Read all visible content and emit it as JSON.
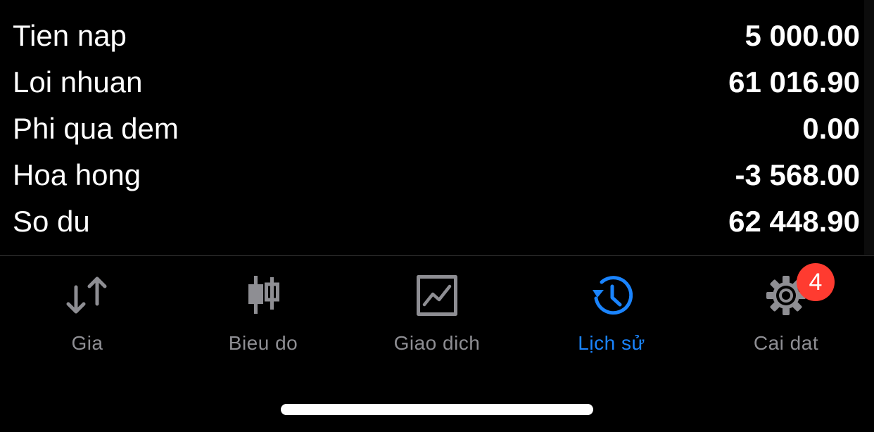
{
  "summary": {
    "rows": [
      {
        "label": "Tien nap",
        "value": "5 000.00"
      },
      {
        "label": "Loi nhuan",
        "value": "61 016.90"
      },
      {
        "label": "Phi qua dem",
        "value": "0.00"
      },
      {
        "label": "Hoa hong",
        "value": "-3 568.00"
      },
      {
        "label": "So du",
        "value": "62 448.90"
      }
    ]
  },
  "tabbar": {
    "tabs": [
      {
        "label": "Gia",
        "icon": "price-arrows-icon",
        "active": false
      },
      {
        "label": "Bieu do",
        "icon": "candlestick-chart-icon",
        "active": false
      },
      {
        "label": "Giao dich",
        "icon": "trade-chart-icon",
        "active": false
      },
      {
        "label": "Lịch sử",
        "icon": "history-icon",
        "active": true
      },
      {
        "label": "Cai dat",
        "icon": "gear-icon",
        "active": false,
        "badge": "4"
      }
    ]
  },
  "colors": {
    "background": "#000000",
    "text": "#ffffff",
    "inactive_tab": "#8e8e93",
    "active_tab": "#1a84ff",
    "badge": "#ff3b30"
  }
}
